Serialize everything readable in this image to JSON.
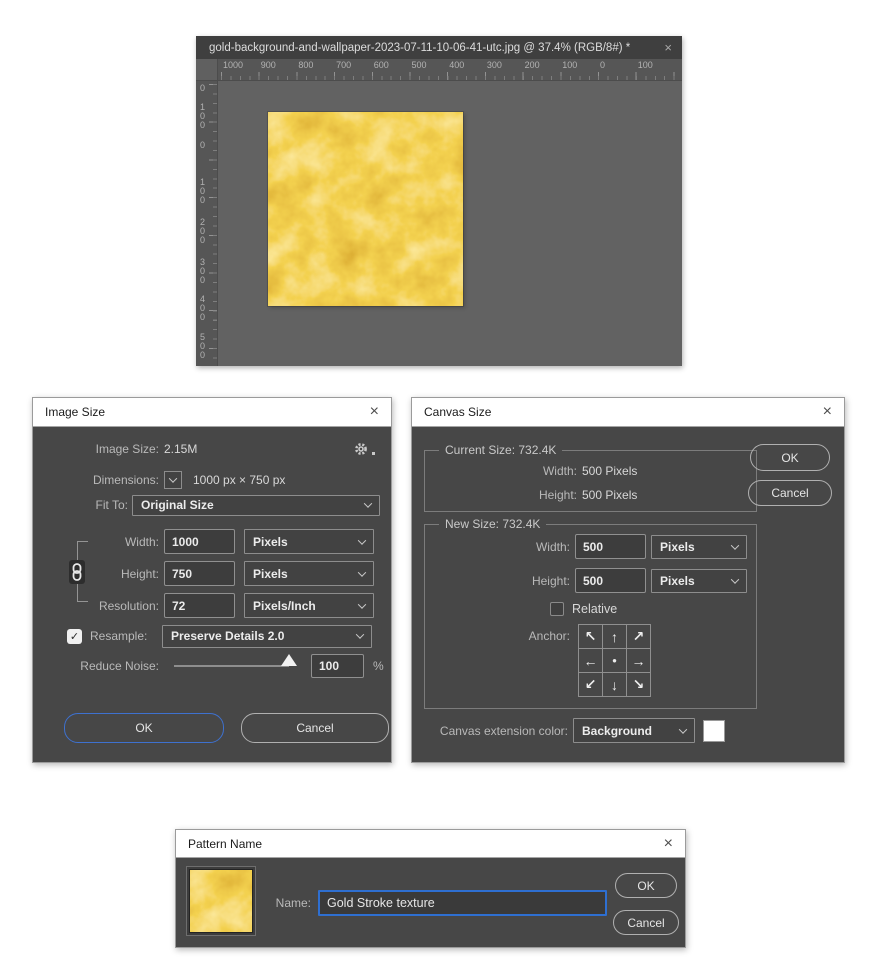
{
  "colors": {
    "accent_blue": "#3e71cf",
    "focus_border_blue": "#2e6fd1",
    "gold_base": "#e8a91a",
    "canvas_gray": "#626262",
    "dialog_gray": "#474747",
    "extension_swatch": "#ffffff"
  },
  "document_window": {
    "title": "gold-background-and-wallpaper-2023-07-11-10-06-41-utc.jpg @ 37.4% (RGB/8#) *",
    "close_glyph": "×",
    "h_ruler_labels": [
      "1000",
      "900",
      "800",
      "700",
      "600",
      "500",
      "400",
      "300",
      "200",
      "100",
      "0",
      "100"
    ],
    "v_ruler_labels": [
      "0",
      "100",
      "0",
      "100",
      "200",
      "300",
      "400",
      "500"
    ]
  },
  "image_size_dialog": {
    "title": "Image Size",
    "close_glyph": "×",
    "image_size_label": "Image Size:",
    "image_size_value": "2.15M",
    "dimensions_label": "Dimensions:",
    "dimensions_value": "1000 px × 750 px",
    "fit_to_label": "Fit To:",
    "fit_to_value": "Original Size",
    "width_label": "Width:",
    "width_value": "1000",
    "width_unit": "Pixels",
    "height_label": "Height:",
    "height_value": "750",
    "height_unit": "Pixels",
    "resolution_label": "Resolution:",
    "resolution_value": "72",
    "resolution_unit": "Pixels/Inch",
    "resample_label": "Resample:",
    "resample_check_glyph": "✓",
    "resample_value": "Preserve Details 2.0",
    "reduce_noise_label": "Reduce Noise:",
    "reduce_noise_value": "100",
    "reduce_noise_unit": "%",
    "ok_label": "OK",
    "cancel_label": "Cancel"
  },
  "canvas_size_dialog": {
    "title": "Canvas Size",
    "close_glyph": "×",
    "current_size": {
      "legend": "Current Size: 732.4K",
      "width_label": "Width:",
      "width_value": "500 Pixels",
      "height_label": "Height:",
      "height_value": "500 Pixels"
    },
    "new_size": {
      "legend": "New Size: 732.4K",
      "width_label": "Width:",
      "width_value": "500",
      "width_unit": "Pixels",
      "height_label": "Height:",
      "height_value": "500",
      "height_unit": "Pixels",
      "relative_label": "Relative",
      "anchor_label": "Anchor:"
    },
    "anchor_arrows": [
      "↖",
      "↑",
      "↗",
      "←",
      "●",
      "→",
      "↙",
      "↓",
      "↘"
    ],
    "extension_label": "Canvas extension color:",
    "extension_value": "Background",
    "ok_label": "OK",
    "cancel_label": "Cancel"
  },
  "pattern_name_dialog": {
    "title": "Pattern Name",
    "close_glyph": "×",
    "name_label": "Name:",
    "name_value": "Gold Stroke texture",
    "ok_label": "OK",
    "cancel_label": "Cancel"
  }
}
